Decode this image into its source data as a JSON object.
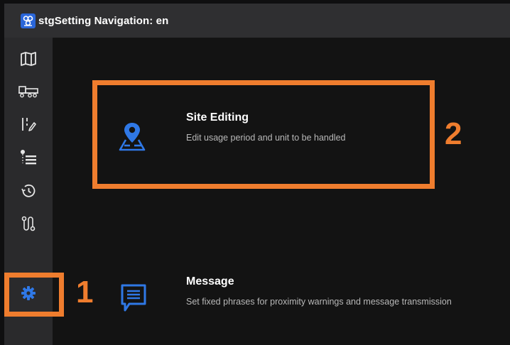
{
  "app": {
    "title": "stgSetting Navigation: en",
    "icon": "app-logo-icon",
    "accent_color": "#2a66d9"
  },
  "sidebar": {
    "items": [
      {
        "name": "map",
        "icon": "map-icon"
      },
      {
        "name": "vehicle",
        "icon": "truck-icon"
      },
      {
        "name": "edit-lines",
        "icon": "edit-list-icon"
      },
      {
        "name": "hierarchy-list",
        "icon": "tree-list-icon"
      },
      {
        "name": "history",
        "icon": "history-icon"
      },
      {
        "name": "route",
        "icon": "route-icon"
      },
      {
        "name": "settings",
        "icon": "gear-icon",
        "active": true
      }
    ]
  },
  "cards": [
    {
      "icon": "map-pin-icon",
      "title": "Site Editing",
      "description": "Edit usage period and unit to be handled"
    },
    {
      "icon": "message-icon",
      "title": "Message",
      "description": "Set fixed phrases for proximity warnings and message transmission"
    }
  ],
  "annotations": {
    "color": "#ef7d2e",
    "labels": [
      "1",
      "2"
    ]
  }
}
